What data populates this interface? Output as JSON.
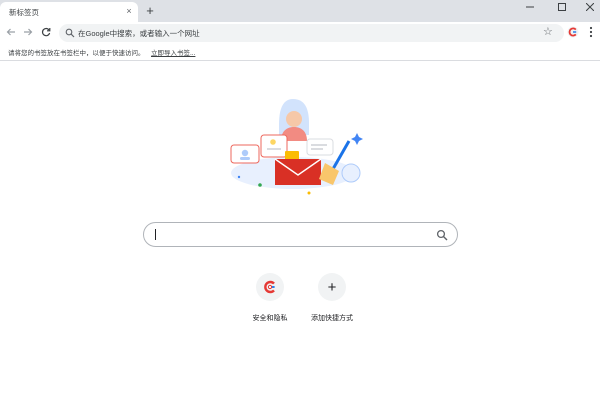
{
  "tab": {
    "title": "新标签页",
    "close_glyph": "×",
    "new_tab_glyph": "+"
  },
  "window_controls": {
    "minimize": "minimize-icon",
    "maximize": "maximize-icon",
    "close": "close-window-icon"
  },
  "toolbar": {
    "omnibox_placeholder": "在Google中搜索，或者输入一个网址",
    "star_glyph": "☆"
  },
  "bookmarks_bar": {
    "hint_text": "请将您的书签放在书签栏中，以便于快速访问。",
    "import_link": "立即导入书签..."
  },
  "search": {
    "value": ""
  },
  "shortcuts": [
    {
      "label": "安全和隐私",
      "icon": "privacy-shield-icon"
    },
    {
      "label": "添加快捷方式",
      "icon": "plus-icon",
      "glyph": "+"
    }
  ],
  "colors": {
    "tab_strip": "#dee1e6",
    "omnibox": "#f1f3f4",
    "accent_red": "#e53935",
    "accent_blue": "#1a73e8"
  }
}
